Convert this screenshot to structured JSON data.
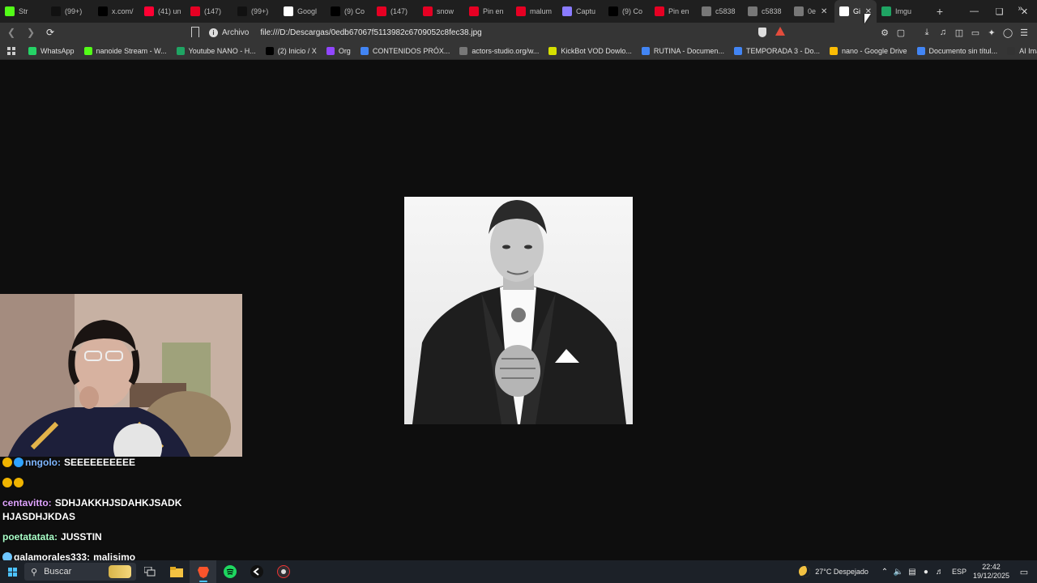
{
  "browser": {
    "tabs": [
      {
        "title": "Str",
        "icon": "kick-icon",
        "color": "#53fc18"
      },
      {
        "title": "(99+)",
        "icon": "tiktok-icon",
        "color": "#111111"
      },
      {
        "title": "x.com/",
        "icon": "x-icon",
        "color": "#000000"
      },
      {
        "title": "(41) un",
        "icon": "youtube-icon",
        "color": "#ff0033"
      },
      {
        "title": "(147)",
        "icon": "pinterest-icon",
        "color": "#e60023"
      },
      {
        "title": "(99+)",
        "icon": "tiktok-icon",
        "color": "#111111"
      },
      {
        "title": "Googl",
        "icon": "google-icon",
        "color": "#ffffff"
      },
      {
        "title": "(9) Co",
        "icon": "x-icon",
        "color": "#000000"
      },
      {
        "title": "(147)",
        "icon": "pinterest-icon",
        "color": "#e60023"
      },
      {
        "title": "snow",
        "icon": "pinterest-icon",
        "color": "#e60023"
      },
      {
        "title": "Pin en",
        "icon": "pinterest-icon",
        "color": "#e60023"
      },
      {
        "title": "malum",
        "icon": "pinterest-icon",
        "color": "#e60023"
      },
      {
        "title": "Captu",
        "icon": "pen-icon",
        "color": "#8a7bff"
      },
      {
        "title": "(9) Co",
        "icon": "x-icon",
        "color": "#000000"
      },
      {
        "title": "Pin en",
        "icon": "pinterest-icon",
        "color": "#e60023"
      },
      {
        "title": "c5838",
        "icon": "globe-icon",
        "color": "#777777"
      },
      {
        "title": "c5838",
        "icon": "globe-icon",
        "color": "#777777"
      },
      {
        "title": "0e",
        "icon": "globe-icon",
        "color": "#777777"
      },
      {
        "title": "Gi",
        "icon": "google-icon",
        "color": "#ffffff"
      },
      {
        "title": "Imgu",
        "icon": "sheet-icon",
        "color": "#1fa463"
      }
    ],
    "active_tab_index": 18,
    "address": {
      "scheme_label": "Archivo",
      "url": "file:///D:/Descargas/0edb67067f5113982c6709052c8fec38.jpg"
    },
    "bookmarks": [
      {
        "label": "WhatsApp",
        "icon": "whatsapp-icon",
        "color": "#25d366"
      },
      {
        "label": "nanoide Stream - W...",
        "icon": "kick-icon",
        "color": "#53fc18"
      },
      {
        "label": "Youtube NANO - H...",
        "icon": "sheet-icon",
        "color": "#1fa463"
      },
      {
        "label": "(2) Inicio / X",
        "icon": "x-icon",
        "color": "#000000"
      },
      {
        "label": "Org",
        "icon": "twitch-icon",
        "color": "#9146ff"
      },
      {
        "label": "CONTENIDOS PRÓX...",
        "icon": "doc-icon",
        "color": "#4285f4"
      },
      {
        "label": "actors-studio.org/w...",
        "icon": "globe-icon",
        "color": "#777777"
      },
      {
        "label": "KickBot VOD Dowlo...",
        "icon": "kickbot-icon",
        "color": "#d6e000"
      },
      {
        "label": "RUTINA - Documen...",
        "icon": "doc-icon",
        "color": "#4285f4"
      },
      {
        "label": "TEMPORADA 3 - Do...",
        "icon": "doc-icon",
        "color": "#4285f4"
      },
      {
        "label": "nano - Google Drive",
        "icon": "drive-icon",
        "color": "#fbbc04"
      },
      {
        "label": "Documento sin títul...",
        "icon": "doc-icon",
        "color": "#4285f4"
      },
      {
        "label": "AI Image Upscaler |...",
        "icon": "ai-icon",
        "color": "#333333"
      }
    ]
  },
  "chat": [
    {
      "user": "nngolo:",
      "text": "SEEEEEEEEEE",
      "badges": [
        "#f0b400",
        "#2fa3ff"
      ]
    },
    {
      "user": "",
      "text": "",
      "badges": [
        "#f0b400",
        "#f0b400"
      ]
    },
    {
      "user": "centavitto:",
      "text": "SDHJAKKHJSDAHKJSADKHJASDHJKDAS",
      "badges": []
    },
    {
      "user": "poetatatata:",
      "text": "JUSSTIN",
      "badges": []
    },
    {
      "user": "galamorales333:",
      "text": "malisimo",
      "badges": [
        "#6ec6ff"
      ]
    }
  ],
  "taskbar": {
    "search_placeholder": "Buscar",
    "weather": "27°C  Despejado",
    "lang": "ESP",
    "time": "22:42",
    "date": "19/12/2025"
  }
}
